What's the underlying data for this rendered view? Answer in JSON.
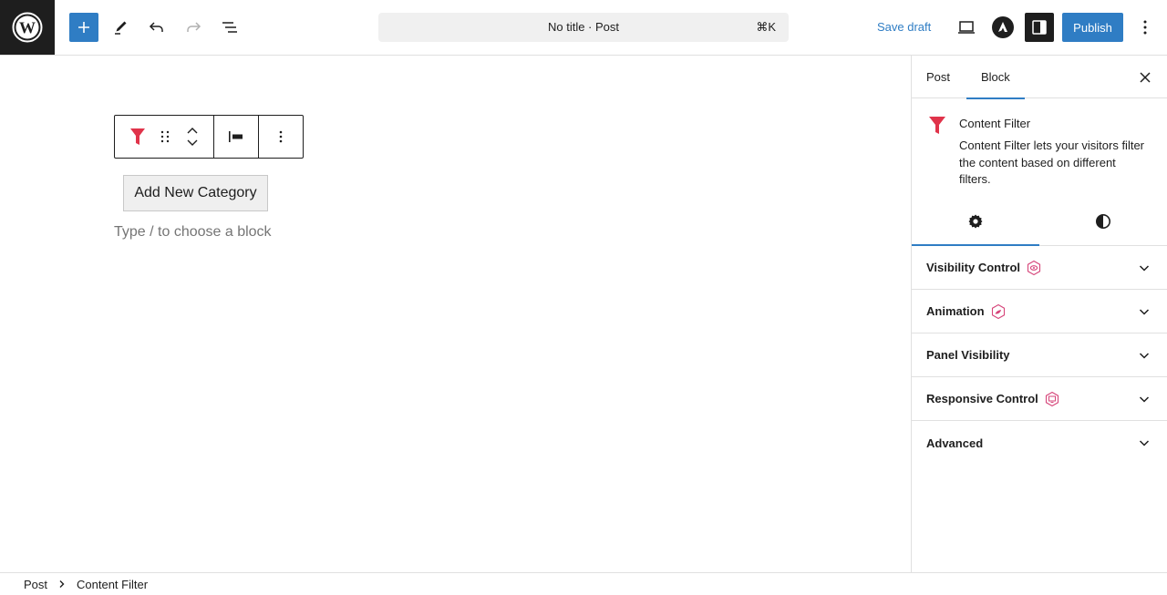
{
  "header": {
    "logo": "wordpress-logo",
    "toolbar_icons": [
      "plus-icon",
      "pencil-icon",
      "undo-icon",
      "redo-icon",
      "list-view-icon"
    ],
    "command_bar": {
      "title": "No title · Post",
      "shortcut": "⌘K"
    },
    "save_draft_label": "Save draft",
    "publish_label": "Publish",
    "right_icons": [
      "preview-desktop-icon",
      "astra-icon",
      "settings-sidebar-icon",
      "more-options-icon"
    ]
  },
  "canvas": {
    "block_toolbar": {
      "icons": [
        "content-filter-icon",
        "drag-handle-icon",
        "move-up-icon",
        "move-down-icon",
        "align-left-icon",
        "more-options-icon"
      ]
    },
    "add_category_label": "Add New Category",
    "placeholder": "Type / to choose a block"
  },
  "sidebar": {
    "tabs": [
      {
        "label": "Post",
        "active": false
      },
      {
        "label": "Block",
        "active": true
      }
    ],
    "block_card": {
      "title": "Content Filter",
      "description": "Content Filter lets your visitors filter the content based on different filters."
    },
    "sub_tabs": [
      {
        "icon": "settings-gear-icon",
        "active": true
      },
      {
        "icon": "styles-contrast-icon",
        "active": false
      }
    ],
    "panels": [
      {
        "title": "Visibility Control",
        "badge": "eye-badge-icon"
      },
      {
        "title": "Animation",
        "badge": "animation-badge-icon"
      },
      {
        "title": "Panel Visibility",
        "badge": null
      },
      {
        "title": "Responsive Control",
        "badge": "responsive-badge-icon"
      },
      {
        "title": "Advanced",
        "badge": null
      }
    ]
  },
  "footer": {
    "breadcrumbs": [
      "Post",
      "Content Filter"
    ]
  },
  "colors": {
    "accent": "#2f7dc4",
    "dark": "#1e1e1e",
    "brand_red": "#e0334a",
    "badge_pink": "#d6457a"
  }
}
